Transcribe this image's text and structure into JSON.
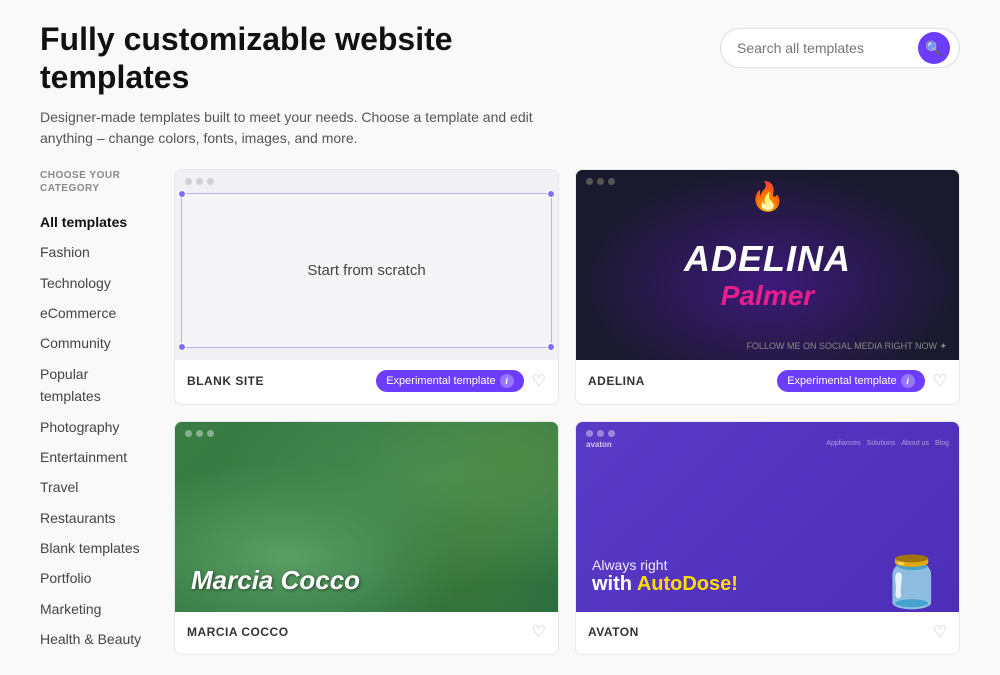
{
  "header": {
    "title": "Fully customizable website templates",
    "description": "Designer-made templates built to meet your needs. Choose a template and edit anything – change colors, fonts, images, and more.",
    "search_placeholder": "Search all templates"
  },
  "sidebar": {
    "category_label": "CHOOSE YOUR CATEGORY",
    "items": [
      {
        "id": "all",
        "label": "All templates",
        "active": true
      },
      {
        "id": "fashion",
        "label": "Fashion",
        "active": false
      },
      {
        "id": "technology",
        "label": "Technology",
        "active": false
      },
      {
        "id": "ecommerce",
        "label": "eCommerce",
        "active": false
      },
      {
        "id": "community",
        "label": "Community",
        "active": false
      },
      {
        "id": "popular",
        "label": "Popular templates",
        "active": false
      },
      {
        "id": "photography",
        "label": "Photography",
        "active": false
      },
      {
        "id": "entertainment",
        "label": "Entertainment",
        "active": false
      },
      {
        "id": "travel",
        "label": "Travel",
        "active": false
      },
      {
        "id": "restaurants",
        "label": "Restaurants",
        "active": false
      },
      {
        "id": "blank",
        "label": "Blank templates",
        "active": false
      },
      {
        "id": "portfolio",
        "label": "Portfolio",
        "active": false
      },
      {
        "id": "marketing",
        "label": "Marketing",
        "active": false
      },
      {
        "id": "health",
        "label": "Health & Beauty",
        "active": false
      }
    ]
  },
  "templates": [
    {
      "id": "blank-site",
      "name": "BLANK SITE",
      "type": "blank",
      "badge": "Experimental template",
      "badge_color": "#6c3cff"
    },
    {
      "id": "adelina",
      "name": "ADELINA",
      "type": "dark",
      "badge": "Experimental template",
      "badge_color": "#6c3cff",
      "title1": "ADELINA",
      "title2": "Palmer"
    },
    {
      "id": "marcia",
      "name": "MARCIA COCCO",
      "type": "nature",
      "badge": null,
      "artist": "Marcia Cocco"
    },
    {
      "id": "autodose",
      "name": "AVATON",
      "type": "promo",
      "badge": null,
      "line1": "Always right",
      "line2": "with AutoDose!"
    }
  ],
  "icons": {
    "search": "🔍",
    "heart": "♡",
    "heart_filled": "♥",
    "info": "i",
    "flame": "🔥"
  }
}
